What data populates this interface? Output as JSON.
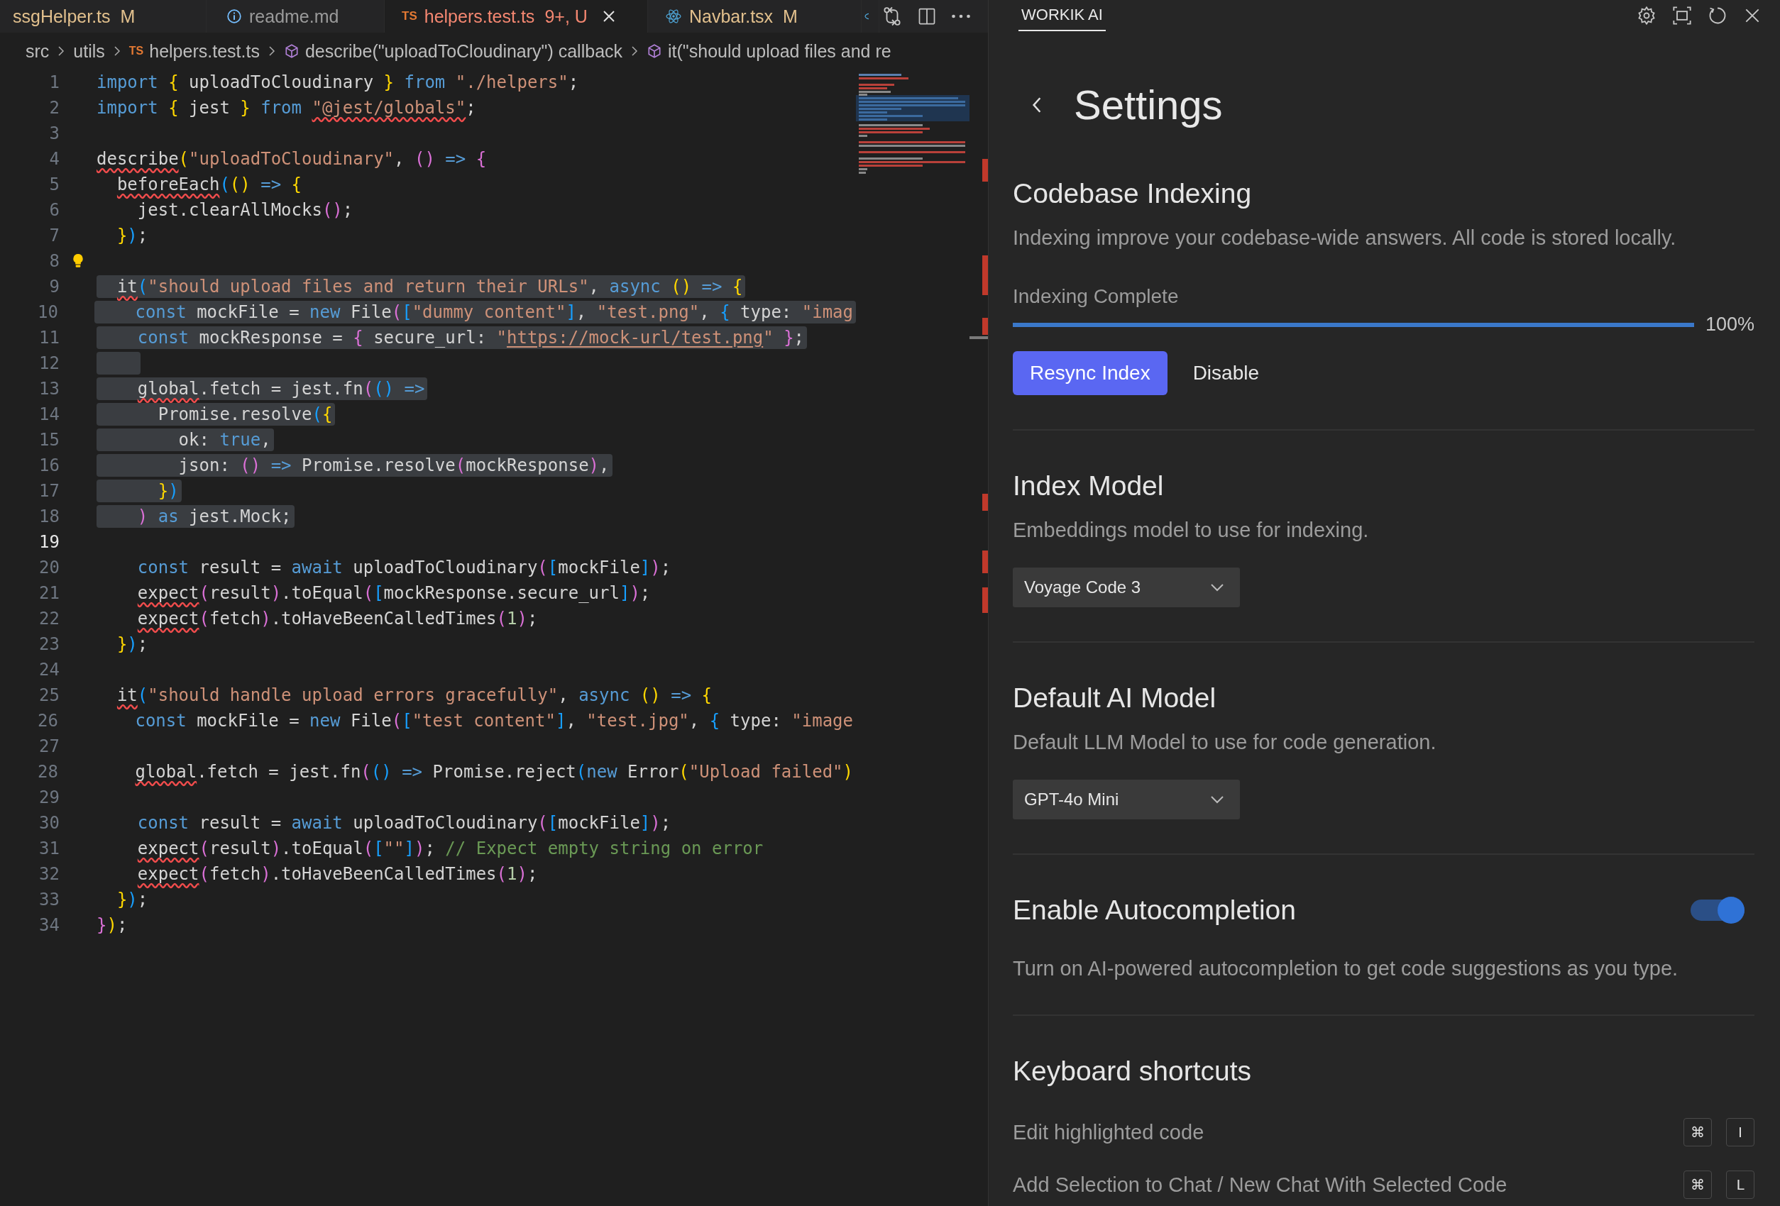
{
  "editor": {
    "tabs": [
      {
        "kind": "plain",
        "label": "ssgHelper.ts",
        "badge": "M",
        "color": "#e2c08d",
        "selected": false
      },
      {
        "kind": "info",
        "label": "readme.md",
        "color": "#9a9a9a",
        "selected": false
      },
      {
        "kind": "typescript",
        "file_icon": "TS",
        "label": "helpers.test.ts",
        "badge": "9+, U",
        "color": "#f48771",
        "selected": true
      },
      {
        "kind": "react",
        "label": "Navbar.tsx",
        "badge": "M",
        "color": "#e2c08d",
        "selected": false
      }
    ],
    "breadcrumbs": [
      {
        "kind": "folder",
        "label": "src"
      },
      {
        "kind": "folder",
        "label": "utils"
      },
      {
        "kind": "file",
        "icon": "TS",
        "label": "helpers.test.ts"
      },
      {
        "kind": "symbol",
        "label": "describe(\"uploadToCloudinary\") callback"
      },
      {
        "kind": "symbol",
        "label": "it(\"should upload files and re"
      }
    ],
    "lines": [
      {
        "number": "1",
        "selected": false,
        "current": false,
        "lightbulb": false,
        "tokens": [
          {
            "text": "import ",
            "kind": "kw"
          },
          {
            "text": "{",
            "kind": "b1"
          },
          {
            "text": " uploadToCloudinary ",
            "kind": "p"
          },
          {
            "text": "} ",
            "kind": "b1"
          },
          {
            "text": "from ",
            "kind": "kw"
          },
          {
            "text": "\"./helpers\"",
            "kind": "str"
          },
          {
            "text": ";",
            "kind": "p"
          }
        ]
      },
      {
        "number": "2",
        "selected": false,
        "current": false,
        "lightbulb": false,
        "tokens": [
          {
            "text": "import ",
            "kind": "kw"
          },
          {
            "text": "{",
            "kind": "b1"
          },
          {
            "text": " jest ",
            "kind": "p"
          },
          {
            "text": "} ",
            "kind": "b1"
          },
          {
            "text": "from ",
            "kind": "kw"
          },
          {
            "text": "\"@jest/globals\"",
            "kind": "str-err"
          },
          {
            "text": ";",
            "kind": "p"
          }
        ]
      },
      {
        "number": "3",
        "selected": false,
        "current": false,
        "lightbulb": false
      },
      {
        "number": "4",
        "selected": false,
        "current": false,
        "lightbulb": false,
        "tokens": [
          {
            "text": "describe",
            "kind": "p-err"
          },
          {
            "text": "(",
            "kind": "b1"
          },
          {
            "text": "\"uploadToCloudinary\"",
            "kind": "str"
          },
          {
            "text": ", ",
            "kind": "p"
          },
          {
            "text": "() ",
            "kind": "b2"
          },
          {
            "text": "=> ",
            "kind": "kw"
          },
          {
            "text": "{",
            "kind": "b2"
          }
        ]
      },
      {
        "number": "5",
        "selected": false,
        "current": false,
        "lightbulb": false,
        "tokens": [
          {
            "text": "  beforeEach",
            "kind": "p-err"
          },
          {
            "text": "(",
            "kind": "b3"
          },
          {
            "text": "() ",
            "kind": "b1"
          },
          {
            "text": "=> ",
            "kind": "kw"
          },
          {
            "text": "{",
            "kind": "b1"
          }
        ]
      },
      {
        "number": "6",
        "selected": false,
        "current": false,
        "lightbulb": false,
        "tokens": [
          {
            "text": "    jest.clearAllMocks",
            "kind": "p"
          },
          {
            "text": "()",
            "kind": "b2"
          },
          {
            "text": ";",
            "kind": "p"
          }
        ]
      },
      {
        "number": "7",
        "selected": false,
        "current": false,
        "lightbulb": false,
        "tokens": [
          {
            "text": "  }",
            "kind": "b1"
          },
          {
            "text": ")",
            "kind": "b3"
          },
          {
            "text": ";",
            "kind": "p"
          }
        ]
      },
      {
        "number": "8",
        "selected": false,
        "current": false,
        "lightbulb": true
      },
      {
        "number": "9",
        "selected": true,
        "current": false,
        "lightbulb": false,
        "tokens": [
          {
            "text": "  it",
            "kind": "p-err"
          },
          {
            "text": "(",
            "kind": "b3"
          },
          {
            "text": "\"should upload files and return their URLs\"",
            "kind": "str"
          },
          {
            "text": ", ",
            "kind": "p"
          },
          {
            "text": "async ",
            "kind": "kw"
          },
          {
            "text": "() ",
            "kind": "b1"
          },
          {
            "text": "=> ",
            "kind": "kw"
          },
          {
            "text": "{",
            "kind": "b1"
          }
        ]
      },
      {
        "number": "10",
        "selected": true,
        "current": false,
        "lightbulb": false,
        "tokens": [
          {
            "text": "    const",
            "kind": "kw"
          },
          {
            "text": " mockFile = ",
            "kind": "p"
          },
          {
            "text": "new",
            "kind": "kw"
          },
          {
            "text": " File",
            "kind": "p"
          },
          {
            "text": "(",
            "kind": "b2"
          },
          {
            "text": "[",
            "kind": "b3"
          },
          {
            "text": "\"dummy content\"",
            "kind": "str"
          },
          {
            "text": "]",
            "kind": "b3"
          },
          {
            "text": ", ",
            "kind": "p"
          },
          {
            "text": "\"test.png\"",
            "kind": "str"
          },
          {
            "text": ", ",
            "kind": "p"
          },
          {
            "text": "{",
            "kind": "b3"
          },
          {
            "text": " type: ",
            "kind": "p"
          },
          {
            "text": "\"imag",
            "kind": "str"
          }
        ]
      },
      {
        "number": "11",
        "selected": true,
        "current": false,
        "lightbulb": false,
        "tokens": [
          {
            "text": "    const",
            "kind": "kw"
          },
          {
            "text": " mockResponse = ",
            "kind": "p"
          },
          {
            "text": "{",
            "kind": "b2"
          },
          {
            "text": " secure_url: ",
            "kind": "p"
          },
          {
            "text": "\"",
            "kind": "str"
          },
          {
            "text": "https://mock-url/test.png",
            "kind": "link"
          },
          {
            "text": "\" ",
            "kind": "str"
          },
          {
            "text": "}",
            "kind": "b2"
          },
          {
            "text": ";",
            "kind": "p"
          }
        ]
      },
      {
        "number": "12",
        "selected": true,
        "current": false,
        "lightbulb": false
      },
      {
        "number": "13",
        "selected": true,
        "current": false,
        "lightbulb": false,
        "tokens": [
          {
            "text": "    global",
            "kind": "p-err"
          },
          {
            "text": ".fetch = jest.fn",
            "kind": "p"
          },
          {
            "text": "(",
            "kind": "b2"
          },
          {
            "text": "() ",
            "kind": "b3"
          },
          {
            "text": "=>",
            "kind": "kw"
          }
        ]
      },
      {
        "number": "14",
        "selected": true,
        "current": false,
        "lightbulb": false,
        "tokens": [
          {
            "text": "      Promise.resolve",
            "kind": "p"
          },
          {
            "text": "(",
            "kind": "b3"
          },
          {
            "text": "{",
            "kind": "b1"
          }
        ]
      },
      {
        "number": "15",
        "selected": true,
        "current": false,
        "lightbulb": false,
        "tokens": [
          {
            "text": "        ok: ",
            "kind": "p"
          },
          {
            "text": "true",
            "kind": "kw"
          },
          {
            "text": ",",
            "kind": "p"
          }
        ]
      },
      {
        "number": "16",
        "selected": true,
        "current": false,
        "lightbulb": false,
        "tokens": [
          {
            "text": "        json: ",
            "kind": "p"
          },
          {
            "text": "() ",
            "kind": "b2"
          },
          {
            "text": "=>",
            "kind": "kw"
          },
          {
            "text": " Promise.resolve",
            "kind": "p"
          },
          {
            "text": "(",
            "kind": "b2"
          },
          {
            "text": "mockResponse",
            "kind": "p"
          },
          {
            "text": ")",
            "kind": "b2"
          },
          {
            "text": ",",
            "kind": "p"
          }
        ]
      },
      {
        "number": "17",
        "selected": true,
        "current": false,
        "lightbulb": false,
        "tokens": [
          {
            "text": "      }",
            "kind": "b1"
          },
          {
            "text": ")",
            "kind": "b3"
          }
        ]
      },
      {
        "number": "18",
        "selected": true,
        "current": false,
        "lightbulb": false,
        "tokens": [
          {
            "text": "    )",
            "kind": "b2"
          },
          {
            "text": " as",
            "kind": "kw"
          },
          {
            "text": " jest.Mock;",
            "kind": "p"
          }
        ]
      },
      {
        "number": "19",
        "selected": false,
        "current": true,
        "lightbulb": false
      },
      {
        "number": "20",
        "selected": false,
        "current": false,
        "lightbulb": false,
        "tokens": [
          {
            "text": "    const",
            "kind": "kw"
          },
          {
            "text": " result = ",
            "kind": "p"
          },
          {
            "text": "await",
            "kind": "kw"
          },
          {
            "text": " uploadToCloudinary",
            "kind": "p"
          },
          {
            "text": "(",
            "kind": "b2"
          },
          {
            "text": "[",
            "kind": "b3"
          },
          {
            "text": "mockFile",
            "kind": "p"
          },
          {
            "text": "]",
            "kind": "b3"
          },
          {
            "text": ")",
            "kind": "b2"
          },
          {
            "text": ";",
            "kind": "p"
          }
        ]
      },
      {
        "number": "21",
        "selected": false,
        "current": false,
        "lightbulb": false,
        "tokens": [
          {
            "text": "    expect",
            "kind": "p-err"
          },
          {
            "text": "(",
            "kind": "b2"
          },
          {
            "text": "result",
            "kind": "p"
          },
          {
            "text": ")",
            "kind": "b2"
          },
          {
            "text": ".toEqual",
            "kind": "p"
          },
          {
            "text": "(",
            "kind": "b2"
          },
          {
            "text": "[",
            "kind": "b3"
          },
          {
            "text": "mockResponse.secure_url",
            "kind": "p"
          },
          {
            "text": "]",
            "kind": "b3"
          },
          {
            "text": ")",
            "kind": "b2"
          },
          {
            "text": ";",
            "kind": "p"
          }
        ]
      },
      {
        "number": "22",
        "selected": false,
        "current": false,
        "lightbulb": false,
        "tokens": [
          {
            "text": "    expect",
            "kind": "p-err"
          },
          {
            "text": "(",
            "kind": "b2"
          },
          {
            "text": "fetch",
            "kind": "p"
          },
          {
            "text": ")",
            "kind": "b2"
          },
          {
            "text": ".toHaveBeenCalledTimes",
            "kind": "p"
          },
          {
            "text": "(",
            "kind": "b2"
          },
          {
            "text": "1",
            "kind": "num"
          },
          {
            "text": ")",
            "kind": "b2"
          },
          {
            "text": ";",
            "kind": "p"
          }
        ]
      },
      {
        "number": "23",
        "selected": false,
        "current": false,
        "lightbulb": false,
        "tokens": [
          {
            "text": "  }",
            "kind": "b1"
          },
          {
            "text": ")",
            "kind": "b3"
          },
          {
            "text": ";",
            "kind": "p"
          }
        ]
      },
      {
        "number": "24",
        "selected": false,
        "current": false,
        "lightbulb": false
      },
      {
        "number": "25",
        "selected": false,
        "current": false,
        "lightbulb": false,
        "tokens": [
          {
            "text": "  it",
            "kind": "p-err"
          },
          {
            "text": "(",
            "kind": "b3"
          },
          {
            "text": "\"should handle upload errors gracefully\"",
            "kind": "str"
          },
          {
            "text": ", ",
            "kind": "p"
          },
          {
            "text": "async ",
            "kind": "kw"
          },
          {
            "text": "() ",
            "kind": "b1"
          },
          {
            "text": "=> ",
            "kind": "kw"
          },
          {
            "text": "{",
            "kind": "b1"
          }
        ]
      },
      {
        "number": "26",
        "selected": false,
        "current": false,
        "lightbulb": false,
        "tokens": [
          {
            "text": "    const",
            "kind": "kw"
          },
          {
            "text": " mockFile = ",
            "kind": "p"
          },
          {
            "text": "new",
            "kind": "kw"
          },
          {
            "text": " File",
            "kind": "p"
          },
          {
            "text": "(",
            "kind": "b2"
          },
          {
            "text": "[",
            "kind": "b3"
          },
          {
            "text": "\"test content\"",
            "kind": "str"
          },
          {
            "text": "]",
            "kind": "b3"
          },
          {
            "text": ", ",
            "kind": "p"
          },
          {
            "text": "\"test.jpg\"",
            "kind": "str"
          },
          {
            "text": ", ",
            "kind": "p"
          },
          {
            "text": "{",
            "kind": "b3"
          },
          {
            "text": " type: ",
            "kind": "p"
          },
          {
            "text": "\"image",
            "kind": "str"
          }
        ]
      },
      {
        "number": "27",
        "selected": false,
        "current": false,
        "lightbulb": false
      },
      {
        "number": "28",
        "selected": false,
        "current": false,
        "lightbulb": false,
        "tokens": [
          {
            "text": "    global",
            "kind": "p-err"
          },
          {
            "text": ".fetch = jest.fn",
            "kind": "p"
          },
          {
            "text": "(",
            "kind": "b2"
          },
          {
            "text": "() ",
            "kind": "b3"
          },
          {
            "text": "=>",
            "kind": "kw"
          },
          {
            "text": " Promise.reject",
            "kind": "p"
          },
          {
            "text": "(",
            "kind": "b3"
          },
          {
            "text": "new",
            "kind": "kw"
          },
          {
            "text": " Error",
            "kind": "p"
          },
          {
            "text": "(",
            "kind": "b1"
          },
          {
            "text": "\"Upload failed\"",
            "kind": "str"
          },
          {
            "text": ")",
            "kind": "b1"
          }
        ]
      },
      {
        "number": "29",
        "selected": false,
        "current": false,
        "lightbulb": false
      },
      {
        "number": "30",
        "selected": false,
        "current": false,
        "lightbulb": false,
        "tokens": [
          {
            "text": "    const",
            "kind": "kw"
          },
          {
            "text": " result = ",
            "kind": "p"
          },
          {
            "text": "await",
            "kind": "kw"
          },
          {
            "text": " uploadToCloudinary",
            "kind": "p"
          },
          {
            "text": "(",
            "kind": "b2"
          },
          {
            "text": "[",
            "kind": "b3"
          },
          {
            "text": "mockFile",
            "kind": "p"
          },
          {
            "text": "]",
            "kind": "b3"
          },
          {
            "text": ")",
            "kind": "b2"
          },
          {
            "text": ";",
            "kind": "p"
          }
        ]
      },
      {
        "number": "31",
        "selected": false,
        "current": false,
        "lightbulb": false,
        "tokens": [
          {
            "text": "    expect",
            "kind": "p-err"
          },
          {
            "text": "(",
            "kind": "b2"
          },
          {
            "text": "result",
            "kind": "p"
          },
          {
            "text": ")",
            "kind": "b2"
          },
          {
            "text": ".toEqual",
            "kind": "p"
          },
          {
            "text": "(",
            "kind": "b2"
          },
          {
            "text": "[",
            "kind": "b3"
          },
          {
            "text": "\"\"",
            "kind": "str"
          },
          {
            "text": "]",
            "kind": "b3"
          },
          {
            "text": ")",
            "kind": "b2"
          },
          {
            "text": "; ",
            "kind": "p"
          },
          {
            "text": "// Expect empty string on error",
            "kind": "com"
          }
        ]
      },
      {
        "number": "32",
        "selected": false,
        "current": false,
        "lightbulb": false,
        "tokens": [
          {
            "text": "    expect",
            "kind": "p-err"
          },
          {
            "text": "(",
            "kind": "b2"
          },
          {
            "text": "fetch",
            "kind": "p"
          },
          {
            "text": ")",
            "kind": "b2"
          },
          {
            "text": ".toHaveBeenCalledTimes",
            "kind": "p"
          },
          {
            "text": "(",
            "kind": "b2"
          },
          {
            "text": "1",
            "kind": "num"
          },
          {
            "text": ")",
            "kind": "b2"
          },
          {
            "text": ";",
            "kind": "p"
          }
        ]
      },
      {
        "number": "33",
        "selected": false,
        "current": false,
        "lightbulb": false,
        "tokens": [
          {
            "text": "  }",
            "kind": "b1"
          },
          {
            "text": ")",
            "kind": "b3"
          },
          {
            "text": ";",
            "kind": "p"
          }
        ]
      },
      {
        "number": "34",
        "selected": false,
        "current": false,
        "lightbulb": false,
        "tokens": [
          {
            "text": "}",
            "kind": "b2"
          },
          {
            "text": ")",
            "kind": "b1"
          },
          {
            "text": ";",
            "kind": "p"
          }
        ]
      }
    ]
  },
  "panel": {
    "tabs": [
      {
        "label": "WORKIK AI",
        "selected": true
      }
    ],
    "title": "Settings",
    "sections": [
      {
        "kind": "indexing",
        "title": "Codebase Indexing",
        "description": "Indexing improve your codebase-wide answers. All code is stored locally.",
        "status": "Indexing Complete",
        "level": 1,
        "reading": "100%",
        "buttons": [
          {
            "label": "Resync Index",
            "kind": "primary"
          },
          {
            "label": "Disable",
            "kind": "plain"
          }
        ]
      },
      {
        "kind": "select",
        "title": "Index Model",
        "description": "Embeddings model to use for indexing.",
        "value": "Voyage Code 3"
      },
      {
        "kind": "select",
        "title": "Default AI Model",
        "description": "Default LLM Model to use for code generation.",
        "value": "GPT-4o Mini"
      },
      {
        "kind": "toggle",
        "title": "Enable Autocompletion",
        "on": true,
        "description": "Turn on AI-powered autocompletion to get code suggestions as you type."
      },
      {
        "kind": "shortcuts",
        "title": "Keyboard shortcuts",
        "items": [
          {
            "label": "Edit highlighted code",
            "keys": [
              "⌘",
              "I"
            ]
          },
          {
            "label": "Add Selection to Chat / New Chat With Selected Code",
            "keys": [
              "⌘",
              "L"
            ]
          }
        ]
      }
    ]
  }
}
